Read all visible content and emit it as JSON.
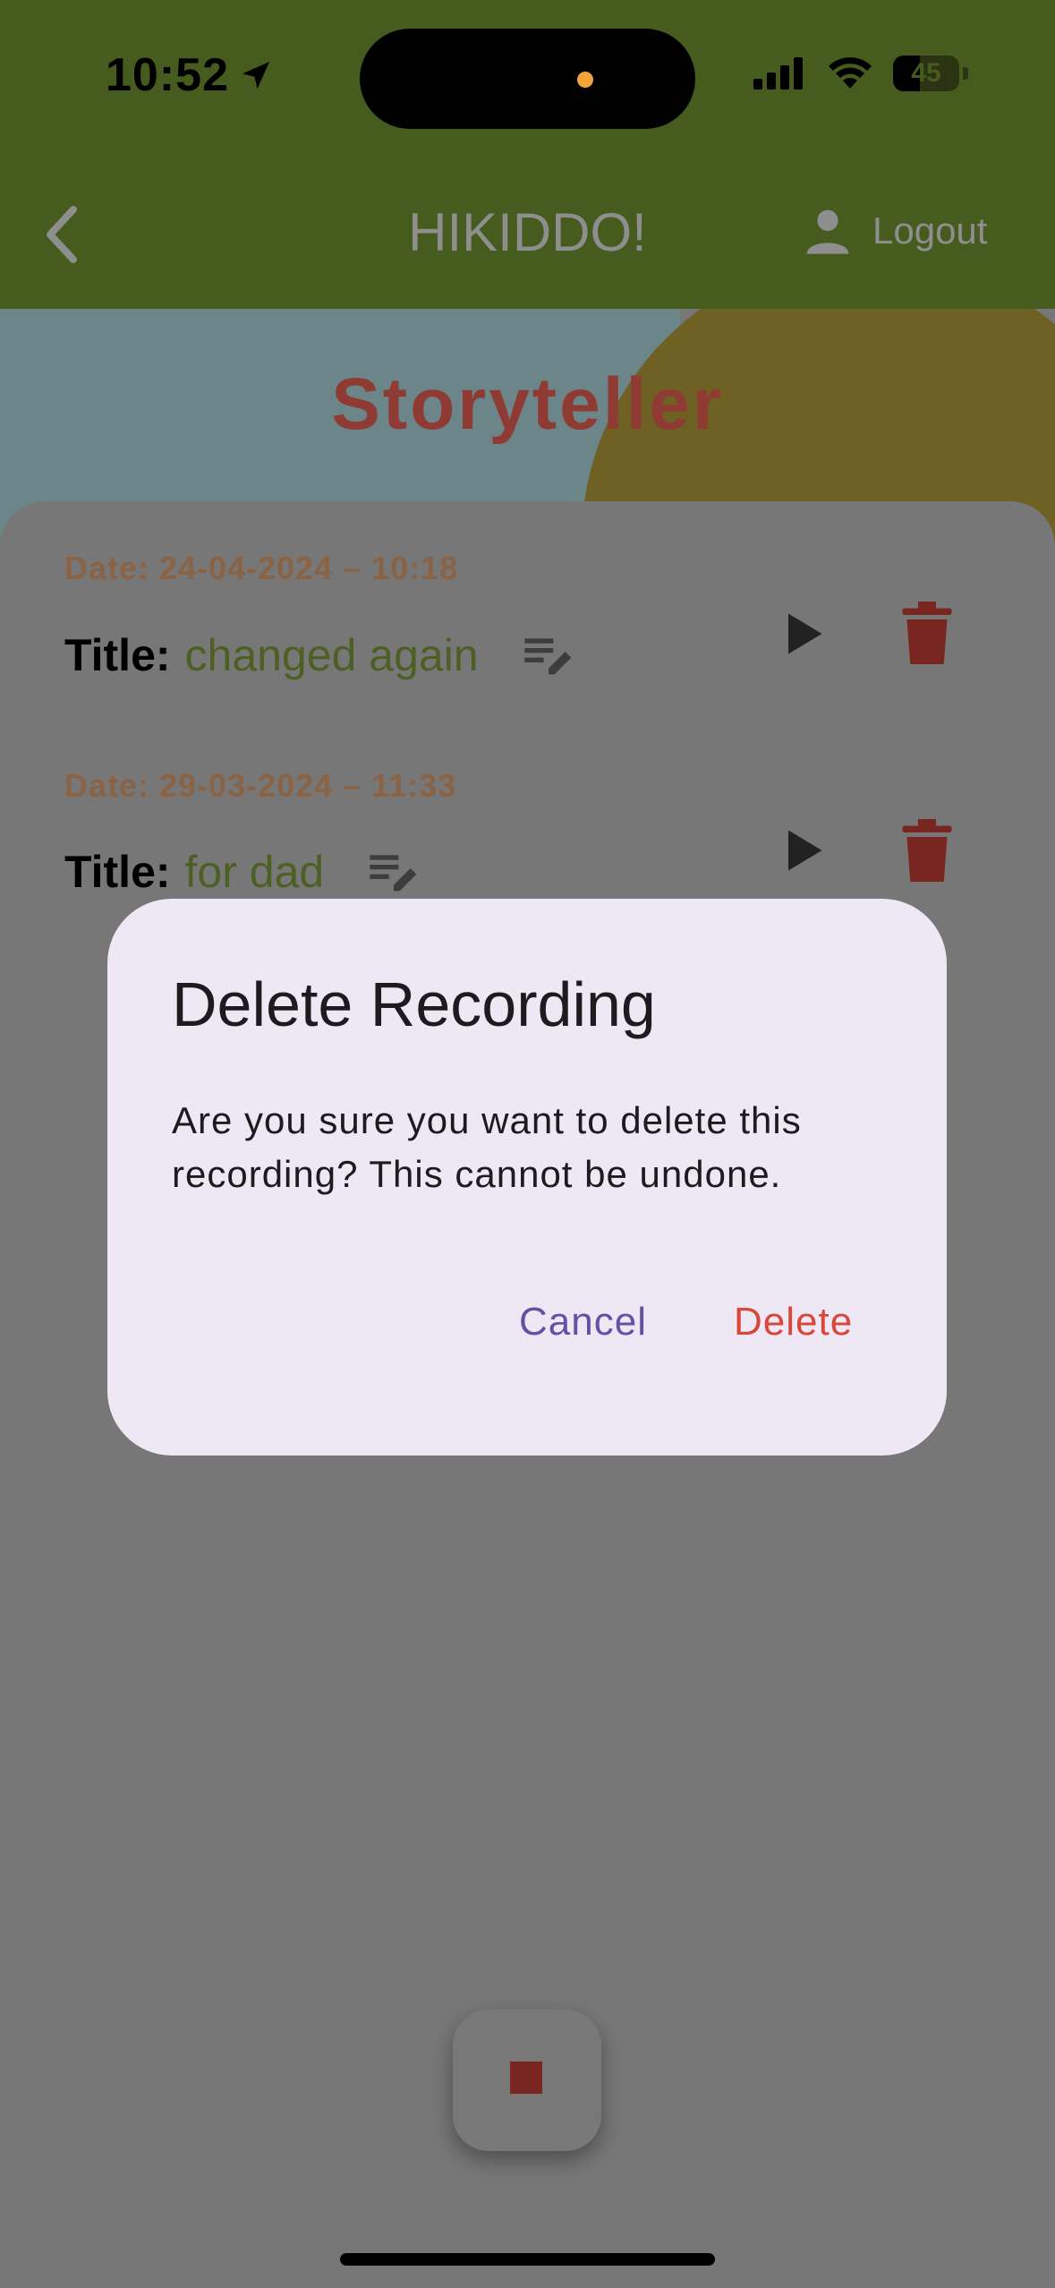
{
  "status_bar": {
    "time": "10:52",
    "battery": "45"
  },
  "app_bar": {
    "title": "HIKIDDO!",
    "logout_label": "Logout"
  },
  "page": {
    "title": "Storyteller"
  },
  "recordings": [
    {
      "date": "Date: 24-04-2024 – 10:18",
      "title_label": "Title:",
      "title_value": "changed again"
    },
    {
      "date": "Date: 29-03-2024 – 11:33",
      "title_label": "Title:",
      "title_value": "for dad"
    }
  ],
  "dialog": {
    "title": "Delete Recording",
    "body": "Are you sure you want to delete this recording? This cannot be undone.",
    "cancel_label": "Cancel",
    "delete_label": "Delete"
  },
  "colors": {
    "app_bar_green": "#465b1e",
    "title_red": "#8f3a33",
    "date_orange": "#8a6244",
    "title_value_green": "#4c6024",
    "dialog_bg": "#eee8f4",
    "cancel_purple": "#6750a4",
    "delete_red": "#d9473c"
  },
  "icons": [
    "back-chevron-icon",
    "location-arrow-icon",
    "signal-icon",
    "wifi-icon",
    "battery-icon",
    "person-icon",
    "edit-list-icon",
    "play-icon",
    "trash-icon",
    "stop-icon"
  ]
}
